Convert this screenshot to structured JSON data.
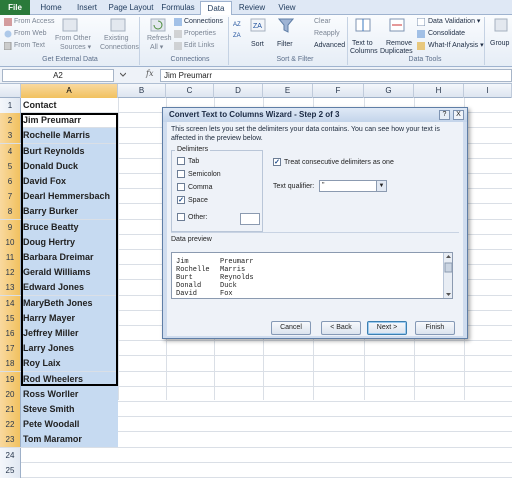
{
  "tabs": {
    "file": "File",
    "items": [
      "Home",
      "Insert",
      "Page Layout",
      "Formulas",
      "Data",
      "Review",
      "View"
    ],
    "active": "Data"
  },
  "ribbon": {
    "get_external": {
      "from_access": "From Access",
      "from_web": "From Web",
      "from_text": "From Text",
      "from_other": "From Other",
      "sources": "Sources ▾",
      "existing": "Existing",
      "connections": "Connections",
      "label": "Get External Data"
    },
    "connections": {
      "refresh": "Refresh",
      "all": "All ▾",
      "connections_btn": "Connections",
      "properties": "Properties",
      "edit_links": "Edit Links",
      "label": "Connections"
    },
    "sort_filter": {
      "sort": "Sort",
      "filter": "Filter",
      "clear": "Clear",
      "reapply": "Reapply",
      "advanced": "Advanced",
      "label": "Sort & Filter"
    },
    "data_tools": {
      "text_to": "Text to",
      "columns": "Columns",
      "remove": "Remove",
      "duplicates": "Duplicates",
      "validation": "Data Validation ▾",
      "consolidate": "Consolidate",
      "what_if": "What-If Analysis ▾",
      "label": "Data Tools"
    },
    "group": "Group"
  },
  "formula_bar": {
    "name_box": "A2",
    "fx": "fx",
    "content": "Jim Preumarr"
  },
  "columns": [
    "A",
    "B",
    "C",
    "D",
    "E",
    "F",
    "G",
    "H",
    "I"
  ],
  "rows": [
    {
      "n": "1",
      "a": "Contact"
    },
    {
      "n": "2",
      "a": "Jim Preumarr"
    },
    {
      "n": "3",
      "a": "Rochelle Marris"
    },
    {
      "n": "4",
      "a": "Burt Reynolds"
    },
    {
      "n": "5",
      "a": "Donald Duck"
    },
    {
      "n": "6",
      "a": "David Fox"
    },
    {
      "n": "7",
      "a": "Dearl Hemmersbach"
    },
    {
      "n": "8",
      "a": "Barry Burker"
    },
    {
      "n": "9",
      "a": "Bruce Beatty"
    },
    {
      "n": "10",
      "a": "Doug Hertry"
    },
    {
      "n": "11",
      "a": "Barbara Dreimar"
    },
    {
      "n": "12",
      "a": "Gerald Williams"
    },
    {
      "n": "13",
      "a": "Edward Jones"
    },
    {
      "n": "14",
      "a": "MaryBeth Jones"
    },
    {
      "n": "15",
      "a": "Harry Mayer"
    },
    {
      "n": "16",
      "a": "Jeffrey Miller"
    },
    {
      "n": "17",
      "a": "Larry Jones"
    },
    {
      "n": "18",
      "a": "Roy Laix"
    },
    {
      "n": "19",
      "a": "Rod Wheelers"
    },
    {
      "n": "20",
      "a": "Ross Worller"
    },
    {
      "n": "21",
      "a": "Steve Smith"
    },
    {
      "n": "22",
      "a": "Pete Woodall"
    },
    {
      "n": "23",
      "a": "Tom Maramor"
    },
    {
      "n": "24",
      "a": ""
    },
    {
      "n": "25",
      "a": ""
    }
  ],
  "dialog": {
    "title": "Convert Text to Columns Wizard - Step 2 of 3",
    "help": "?",
    "close": "X",
    "description": "This screen lets you set the delimiters your data contains. You can see how your text is affected in the preview below.",
    "delimiters_label": "Delimiters",
    "delimiters": [
      {
        "label": "Tab",
        "checked": false
      },
      {
        "label": "Semicolon",
        "checked": false
      },
      {
        "label": "Comma",
        "checked": false
      },
      {
        "label": "Space",
        "checked": true
      },
      {
        "label": "Other:",
        "checked": false
      }
    ],
    "treat_consecutive": "Treat consecutive delimiters as one",
    "treat_checked": true,
    "text_qualifier_label": "Text qualifier:",
    "text_qualifier_value": "\"",
    "preview_label": "Data preview",
    "preview_rows": [
      [
        "Jim",
        "Preumarr"
      ],
      [
        "Rochelle",
        "Marris"
      ],
      [
        "Burt",
        "Reynolds"
      ],
      [
        "Donald",
        "Duck"
      ],
      [
        "David",
        "Fox"
      ]
    ],
    "buttons": {
      "cancel": "Cancel",
      "back": "< Back",
      "next": "Next >",
      "finish": "Finish"
    }
  }
}
